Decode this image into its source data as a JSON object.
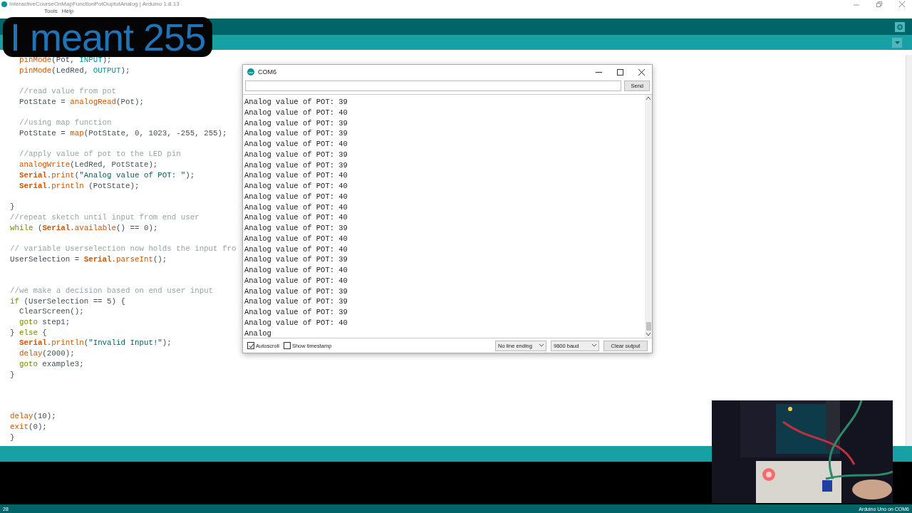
{
  "window": {
    "title": "InteractiveCourseOnMapFunctionPotOuptutAnalog | Arduino 1.8.13"
  },
  "menu": [
    "Tools",
    "Help"
  ],
  "caption": "I meant 255",
  "editor": {
    "lines": [
      {
        "kind": "code",
        "segments": [
          {
            "kind": "function",
            "text": "  pinMode"
          },
          {
            "kind": "plain",
            "text": "(Pot, "
          },
          {
            "kind": "constant",
            "text": "INPUT"
          },
          {
            "kind": "plain",
            "text": ");"
          }
        ]
      },
      {
        "kind": "code",
        "segments": [
          {
            "kind": "function",
            "text": "  pinMode"
          },
          {
            "kind": "plain",
            "text": "(LedRed, "
          },
          {
            "kind": "constant",
            "text": "OUTPUT"
          },
          {
            "kind": "plain",
            "text": ");"
          }
        ]
      },
      {
        "kind": "blank"
      },
      {
        "kind": "code",
        "segments": [
          {
            "kind": "comment",
            "text": "  //read value from pot"
          }
        ]
      },
      {
        "kind": "code",
        "segments": [
          {
            "kind": "plain",
            "text": "  PotState = "
          },
          {
            "kind": "function",
            "text": "analogRead"
          },
          {
            "kind": "plain",
            "text": "(Pot);"
          }
        ]
      },
      {
        "kind": "blank"
      },
      {
        "kind": "code",
        "segments": [
          {
            "kind": "comment",
            "text": "  //using map function"
          }
        ]
      },
      {
        "kind": "code",
        "segments": [
          {
            "kind": "plain",
            "text": "  PotState = "
          },
          {
            "kind": "function",
            "text": "map"
          },
          {
            "kind": "plain",
            "text": "(PotState, 0, 1023, -255, 255);"
          }
        ]
      },
      {
        "kind": "blank"
      },
      {
        "kind": "code",
        "segments": [
          {
            "kind": "comment",
            "text": "  //apply value of pot to the LED pin"
          }
        ]
      },
      {
        "kind": "code",
        "segments": [
          {
            "kind": "function",
            "text": "  analogWrite"
          },
          {
            "kind": "plain",
            "text": "(LedRed, PotState);"
          }
        ]
      },
      {
        "kind": "code",
        "segments": [
          {
            "kind": "serial",
            "text": "  Serial"
          },
          {
            "kind": "plain",
            "text": "."
          },
          {
            "kind": "function",
            "text": "print"
          },
          {
            "kind": "plain",
            "text": "("
          },
          {
            "kind": "string",
            "text": "\"Analog value of POT: \""
          },
          {
            "kind": "plain",
            "text": ");"
          }
        ]
      },
      {
        "kind": "code",
        "segments": [
          {
            "kind": "serial",
            "text": "  Serial"
          },
          {
            "kind": "plain",
            "text": "."
          },
          {
            "kind": "function",
            "text": "println"
          },
          {
            "kind": "plain",
            "text": " (PotState);"
          }
        ]
      },
      {
        "kind": "blank"
      },
      {
        "kind": "code",
        "segments": [
          {
            "kind": "plain",
            "text": "}"
          }
        ]
      },
      {
        "kind": "code",
        "segments": [
          {
            "kind": "comment",
            "text": "//repeat sketch until input from end user"
          }
        ]
      },
      {
        "kind": "code",
        "segments": [
          {
            "kind": "control",
            "text": "while"
          },
          {
            "kind": "plain",
            "text": " ("
          },
          {
            "kind": "serial",
            "text": "Serial"
          },
          {
            "kind": "plain",
            "text": "."
          },
          {
            "kind": "function",
            "text": "available"
          },
          {
            "kind": "plain",
            "text": "() == 0);"
          }
        ]
      },
      {
        "kind": "blank"
      },
      {
        "kind": "code",
        "segments": [
          {
            "kind": "comment",
            "text": "// variable Userselection now holds the input fro"
          }
        ]
      },
      {
        "kind": "code",
        "segments": [
          {
            "kind": "plain",
            "text": "UserSelection = "
          },
          {
            "kind": "serial",
            "text": "Serial"
          },
          {
            "kind": "plain",
            "text": "."
          },
          {
            "kind": "function",
            "text": "parseInt"
          },
          {
            "kind": "plain",
            "text": "();"
          }
        ]
      },
      {
        "kind": "blank"
      },
      {
        "kind": "blank"
      },
      {
        "kind": "code",
        "segments": [
          {
            "kind": "comment",
            "text": "//we make a decision based on end user input"
          }
        ]
      },
      {
        "kind": "code",
        "segments": [
          {
            "kind": "control",
            "text": "if"
          },
          {
            "kind": "plain",
            "text": " (UserSelection == 5) {"
          }
        ]
      },
      {
        "kind": "code",
        "segments": [
          {
            "kind": "plain",
            "text": "  ClearScreen();"
          }
        ]
      },
      {
        "kind": "code",
        "segments": [
          {
            "kind": "control",
            "text": "  goto"
          },
          {
            "kind": "plain",
            "text": " step1;"
          }
        ]
      },
      {
        "kind": "code",
        "segments": [
          {
            "kind": "plain",
            "text": "} "
          },
          {
            "kind": "control",
            "text": "else"
          },
          {
            "kind": "plain",
            "text": " {"
          }
        ]
      },
      {
        "kind": "code",
        "segments": [
          {
            "kind": "serial",
            "text": "  Serial"
          },
          {
            "kind": "plain",
            "text": "."
          },
          {
            "kind": "function",
            "text": "println"
          },
          {
            "kind": "plain",
            "text": "("
          },
          {
            "kind": "string",
            "text": "\"Invalid Input!\""
          },
          {
            "kind": "plain",
            "text": ");"
          }
        ]
      },
      {
        "kind": "code",
        "segments": [
          {
            "kind": "function",
            "text": "  delay"
          },
          {
            "kind": "plain",
            "text": "(2000);"
          }
        ]
      },
      {
        "kind": "code",
        "segments": [
          {
            "kind": "control",
            "text": "  goto"
          },
          {
            "kind": "plain",
            "text": " example3;"
          }
        ]
      },
      {
        "kind": "code",
        "segments": [
          {
            "kind": "plain",
            "text": "}"
          }
        ]
      },
      {
        "kind": "blank"
      },
      {
        "kind": "blank"
      },
      {
        "kind": "blank"
      },
      {
        "kind": "code",
        "segments": [
          {
            "kind": "function",
            "text": "delay"
          },
          {
            "kind": "plain",
            "text": "(10);"
          }
        ]
      },
      {
        "kind": "code",
        "segments": [
          {
            "kind": "function",
            "text": "exit"
          },
          {
            "kind": "plain",
            "text": "(0);"
          }
        ]
      },
      {
        "kind": "code",
        "segments": [
          {
            "kind": "plain",
            "text": "}"
          }
        ]
      }
    ]
  },
  "serial_monitor": {
    "title": "COM6",
    "send_button": "Send",
    "output": [
      "Analog value of POT: 39",
      "Analog value of POT: 40",
      "Analog value of POT: 39",
      "Analog value of POT: 39",
      "Analog value of POT: 40",
      "Analog value of POT: 39",
      "Analog value of POT: 39",
      "Analog value of POT: 40",
      "Analog value of POT: 40",
      "Analog value of POT: 40",
      "Analog value of POT: 40",
      "Analog value of POT: 40",
      "Analog value of POT: 39",
      "Analog value of POT: 40",
      "Analog value of POT: 40",
      "Analog value of POT: 39",
      "Analog value of POT: 40",
      "Analog value of POT: 40",
      "Analog value of POT: 39",
      "Analog value of POT: 39",
      "Analog value of POT: 39",
      "Analog value of POT: 40",
      "Analog"
    ],
    "autoscroll": {
      "label": "Autoscroll",
      "checked": true
    },
    "show_timestamp": {
      "label": "Show timestamp",
      "checked": false
    },
    "line_ending": "No line ending",
    "baud": "9600 baud",
    "clear_button": "Clear output"
  },
  "status_bar": {
    "line": "28",
    "board": "Arduino Uno on COM6"
  }
}
